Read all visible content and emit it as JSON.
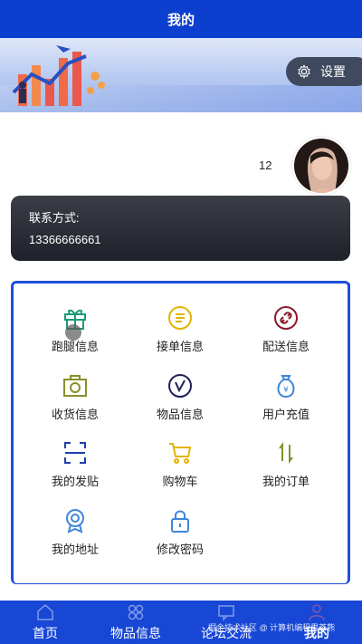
{
  "header": {
    "title": "我的"
  },
  "settings": {
    "label": "设置",
    "icon": "gear-icon"
  },
  "user": {
    "number": "12"
  },
  "contact": {
    "label": "联系方式:",
    "phone": "13366666661"
  },
  "menu": [
    {
      "label": "跑腿信息",
      "icon": "gift-icon",
      "color": "#1a9a78"
    },
    {
      "label": "接单信息",
      "icon": "order-list-icon",
      "color": "#e2b400"
    },
    {
      "label": "配送信息",
      "icon": "link-icon",
      "color": "#8b1a2b"
    },
    {
      "label": "收货信息",
      "icon": "camera-icon",
      "color": "#8a8f2a"
    },
    {
      "label": "物品信息",
      "icon": "check-circle-icon",
      "color": "#20205a"
    },
    {
      "label": "用户充值",
      "icon": "money-bag-icon",
      "color": "#3f86d8"
    },
    {
      "label": "我的发贴",
      "icon": "scan-icon",
      "color": "#1e3fb0"
    },
    {
      "label": "购物车",
      "icon": "cart-icon",
      "color": "#e2b400"
    },
    {
      "label": "我的订单",
      "icon": "sort-icon",
      "color": "#8a8f2a"
    },
    {
      "label": "我的地址",
      "icon": "badge-icon",
      "color": "#3f86d8"
    },
    {
      "label": "修改密码",
      "icon": "lock-icon",
      "color": "#3f86d8"
    }
  ],
  "tabbar": {
    "items": [
      {
        "label": "首页",
        "icon": "home-icon"
      },
      {
        "label": "物品信息",
        "icon": "grid-icon"
      },
      {
        "label": "论坛交流",
        "icon": "chat-icon"
      },
      {
        "label": "我的",
        "icon": "user-icon"
      }
    ]
  },
  "watermark": "掘金技术社区 @ 计算机编程果茶熊"
}
